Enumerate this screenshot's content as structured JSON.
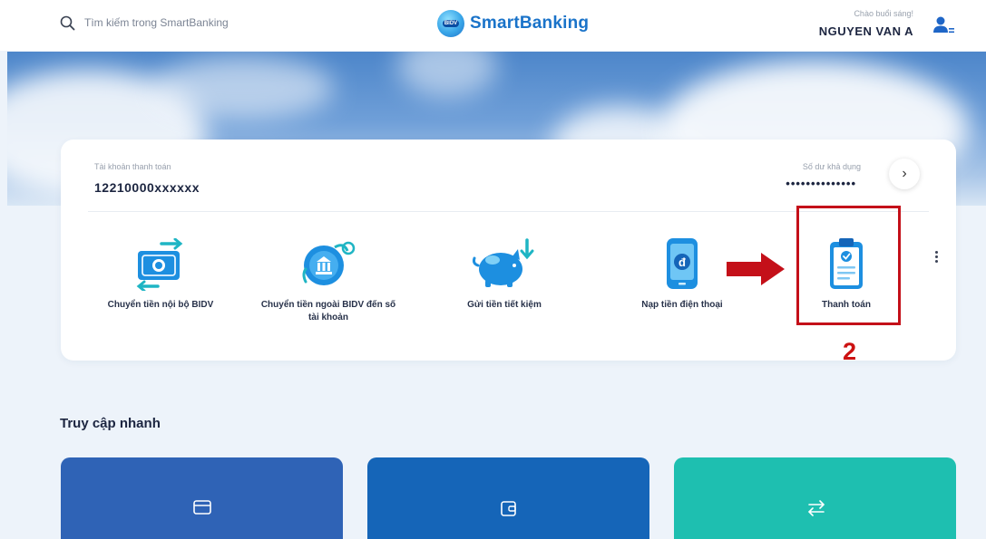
{
  "header": {
    "search_placeholder": "Tìm kiếm trong SmartBanking",
    "logo_text": "SmartBanking",
    "logo_badge": "BIDV",
    "greeting": "Chào buổi sáng!",
    "user_name": "NGUYEN VAN A"
  },
  "account": {
    "label": "Tài khoản thanh toán",
    "number": "12210000xxxxxx",
    "balance_label": "Số dư khả dụng",
    "balance_masked": "••••••••••••••",
    "chevron": "›"
  },
  "actions": [
    {
      "label": "Chuyển tiền nội bộ BIDV",
      "icon": "internal-transfer-icon"
    },
    {
      "label": "Chuyển tiền ngoài BIDV đến số tài khoản",
      "icon": "external-transfer-icon"
    },
    {
      "label": "Gửi tiền tiết kiệm",
      "icon": "piggy-bank-icon"
    },
    {
      "label": "Nạp tiền điện thoại",
      "icon": "phone-topup-icon"
    },
    {
      "label": "Thanh toán",
      "icon": "payment-clipboard-icon"
    }
  ],
  "annotation": {
    "step_number": "2",
    "color": "#c41019"
  },
  "quick_access": {
    "title": "Truy cập nhanh",
    "tiles": [
      {
        "icon": "card-icon",
        "color": "#2f63b6"
      },
      {
        "icon": "wallet-icon",
        "color": "#1565b8"
      },
      {
        "icon": "transfer-arrows-icon",
        "color": "#1ebfb0"
      }
    ]
  },
  "colors": {
    "brand": "#1a73c9",
    "icon_blue": "#1d8fe0",
    "icon_teal": "#1fb5c4"
  }
}
